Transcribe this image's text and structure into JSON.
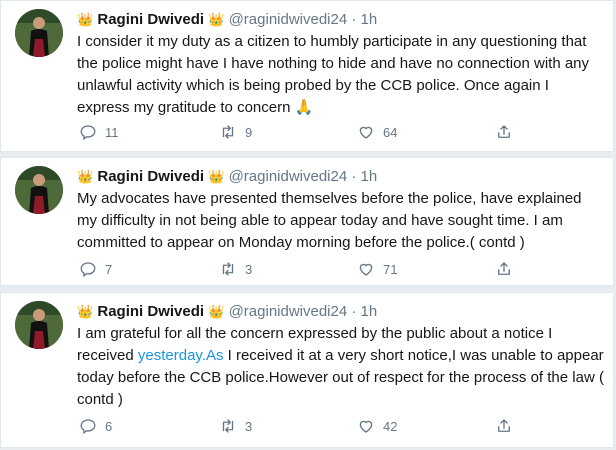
{
  "tweets": [
    {
      "crown_left": "👑",
      "name": "Ragini Dwivedi",
      "crown_right": "👑",
      "handle": "@raginidwivedi24",
      "time": "· 1h",
      "text": "I consider it my duty as a citizen to humbly participate in any questioning that the police might have I have nothing to hide and have no connection with any unlawful activity which is being probed by the CCB police. Once again I express my gratitude to concern 🙏",
      "link_text": "",
      "text_after": "",
      "replies": "11",
      "retweets": "9",
      "likes": "64"
    },
    {
      "crown_left": "👑",
      "name": "Ragini Dwivedi",
      "crown_right": "👑",
      "handle": "@raginidwivedi24",
      "time": "· 1h",
      "text": "My advocates have presented themselves before the police, have explained my difficulty in not being able to appear today and have sought time. I am committed to appear on Monday morning before the police.( contd )",
      "link_text": "",
      "text_after": "",
      "replies": "7",
      "retweets": "3",
      "likes": "71"
    },
    {
      "crown_left": "👑",
      "name": "Ragini Dwivedi",
      "crown_right": "👑",
      "handle": "@raginidwivedi24",
      "time": "· 1h",
      "text": "I am grateful for all the concern expressed by the public about a notice I received ",
      "link_text": "yesterday.As",
      "text_after": " I received it at a very short notice,I was unable to appear today before the CCB police.However out of respect for the process of the law ( contd )",
      "replies": "6",
      "retweets": "3",
      "likes": "42"
    }
  ],
  "colors": {
    "link": "#1b95e0",
    "meta": "#657786",
    "crown": "#d4a017"
  }
}
